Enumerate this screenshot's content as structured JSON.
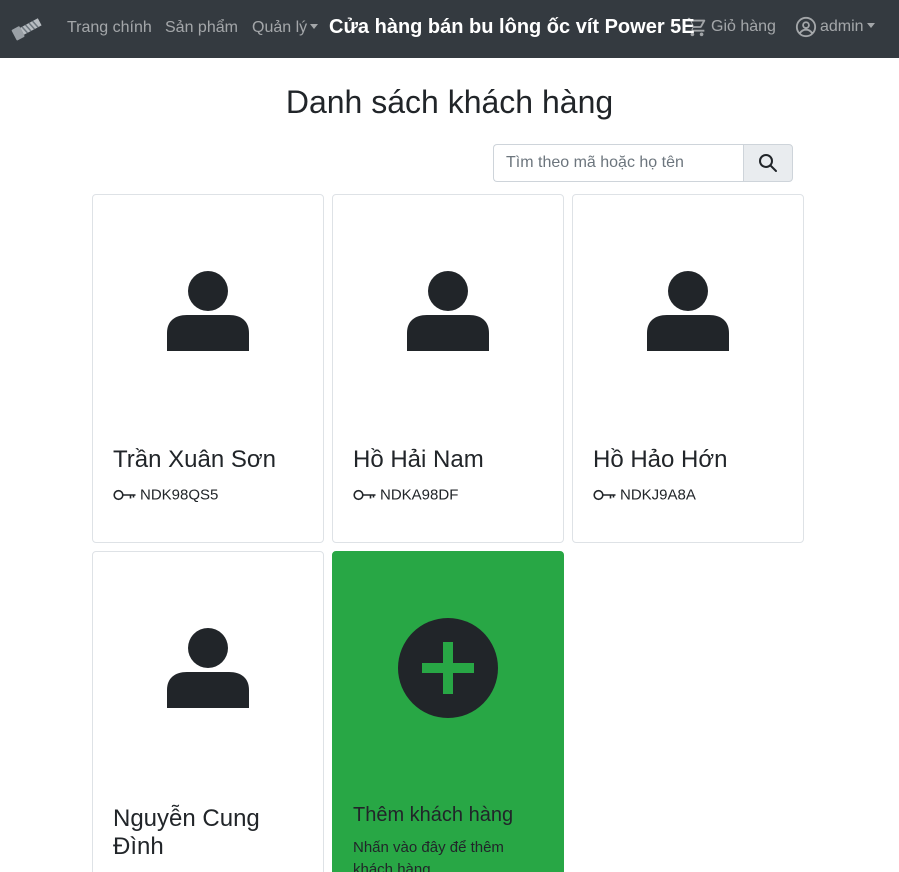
{
  "nav": {
    "logo_icon": "bolt-screw-icon",
    "home": "Trang chính",
    "products": "Sản phẩm",
    "manage": "Quản lý",
    "brand": "Cửa hàng bán bu lông ốc vít Power 5E",
    "cart_icon": "cart-icon",
    "cart": "Giỏ hàng",
    "user_icon": "user-circle-icon",
    "user": "admin"
  },
  "page": {
    "title": "Danh sách khách hàng"
  },
  "search": {
    "placeholder": "Tìm theo mã hoặc họ tên",
    "value": "",
    "button_icon": "search-icon"
  },
  "customers": [
    {
      "name": "Trần Xuân Sơn",
      "code": "NDK98QS5"
    },
    {
      "name": "Hồ Hải Nam",
      "code": "NDKA98DF"
    },
    {
      "name": "Hồ Hảo Hớn",
      "code": "NDKJ9A8A"
    },
    {
      "name": "Nguyễn Cung Đình",
      "code": ""
    }
  ],
  "add_card": {
    "title": "Thêm khách hàng",
    "text": "Nhấn vào đây để thêm khách hàng",
    "icon": "plus-circle-icon"
  },
  "colors": {
    "navbar": "#343a40",
    "add_card": "#28a745",
    "text": "#212529"
  }
}
